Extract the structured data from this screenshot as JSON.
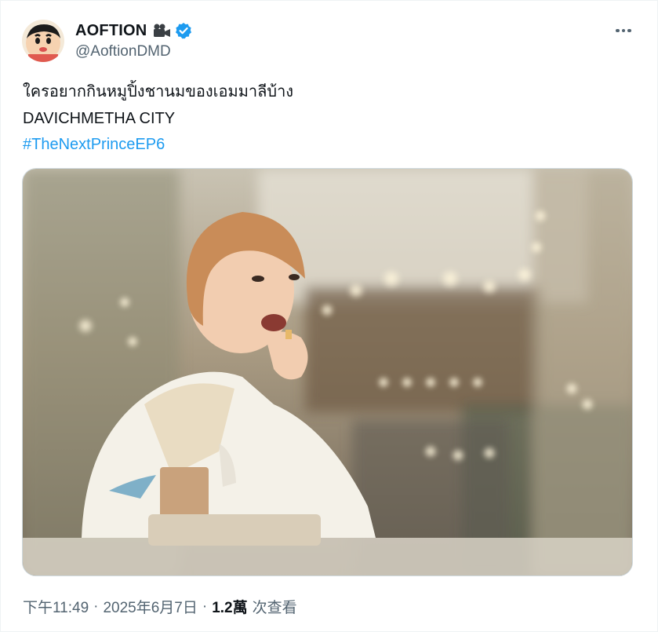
{
  "author": {
    "display_name": "AOFTION",
    "handle": "@AoftionDMD",
    "badge_icon": "movie-camera-icon",
    "verified_icon": "verified-badge-icon",
    "verified_color": "#1d9bf0"
  },
  "tweet": {
    "line1": "ใครอยากกินหมูปิ้งชานมของเอมมาลีบ้าง",
    "line2": "DAVICHMETHA CITY",
    "hashtag": "#TheNextPrinceEP6",
    "hashtag_color": "#1d9bf0"
  },
  "media": {
    "icon": "photo-image"
  },
  "meta": {
    "time": "下午11:49",
    "separator": "·",
    "date": "2025年6月7日",
    "views_count": "1.2萬",
    "views_label": "次查看"
  },
  "more_icon": "more-dots-icon"
}
